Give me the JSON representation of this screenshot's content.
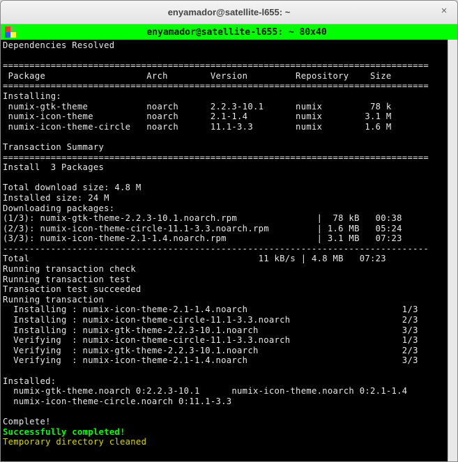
{
  "window": {
    "title": "enyamador@satellite-l655: ~",
    "close_glyph": "×"
  },
  "menubar": {
    "title": "enyamador@satellite-l655: ~ 80x40"
  },
  "term": {
    "deps_resolved": "Dependencies Resolved",
    "hr1": "================================================================================",
    "hdr": " Package                   Arch        Version         Repository    Size",
    "hr2": "================================================================================",
    "installing_hdr": "Installing:",
    "pkg1": " numix-gtk-theme           noarch      2.2.3-10.1      numix         78 k",
    "pkg2": " numix-icon-theme          noarch      2.1-1.4         numix        3.1 M",
    "pkg3": " numix-icon-theme-circle   noarch      11.1-3.3        numix        1.6 M",
    "tx_summary": "Transaction Summary",
    "hr3": "================================================================================",
    "install_count": "Install  3 Packages",
    "dl_size": "Total download size: 4.8 M",
    "inst_size": "Installed size: 24 M",
    "dl_hdr": "Downloading packages:",
    "dl1": "(1/3): numix-gtk-theme-2.2.3-10.1.noarch.rpm               |  78 kB   00:38",
    "dl2": "(2/3): numix-icon-theme-circle-11.1-3.3.noarch.rpm         | 1.6 MB   05:24",
    "dl3": "(3/3): numix-icon-theme-2.1-1.4.noarch.rpm                 | 3.1 MB   07:23",
    "hr4": "--------------------------------------------------------------------------------",
    "total": "Total                                           11 kB/s | 4.8 MB   07:23",
    "rtc": "Running transaction check",
    "rtt": "Running transaction test",
    "tts": "Transaction test succeeded",
    "rt": "Running transaction",
    "ins1": "  Installing : numix-icon-theme-2.1-1.4.noarch                             1/3",
    "ins2": "  Installing : numix-icon-theme-circle-11.1-3.3.noarch                     2/3",
    "ins3": "  Installing : numix-gtk-theme-2.2.3-10.1.noarch                           3/3",
    "ver1": "  Verifying  : numix-icon-theme-circle-11.1-3.3.noarch                     1/3",
    "ver2": "  Verifying  : numix-gtk-theme-2.2.3-10.1.noarch                           2/3",
    "ver3": "  Verifying  : numix-icon-theme-2.1-1.4.noarch                             3/3",
    "installed_hdr": "Installed:",
    "installed1": "  numix-gtk-theme.noarch 0:2.2.3-10.1      numix-icon-theme.noarch 0:2.1-1.4",
    "installed2": "  numix-icon-theme-circle.noarch 0:11.1-3.3",
    "complete": "Complete!",
    "success": "Successfully completed!",
    "tmpdir": "Temporary directory cleaned"
  }
}
